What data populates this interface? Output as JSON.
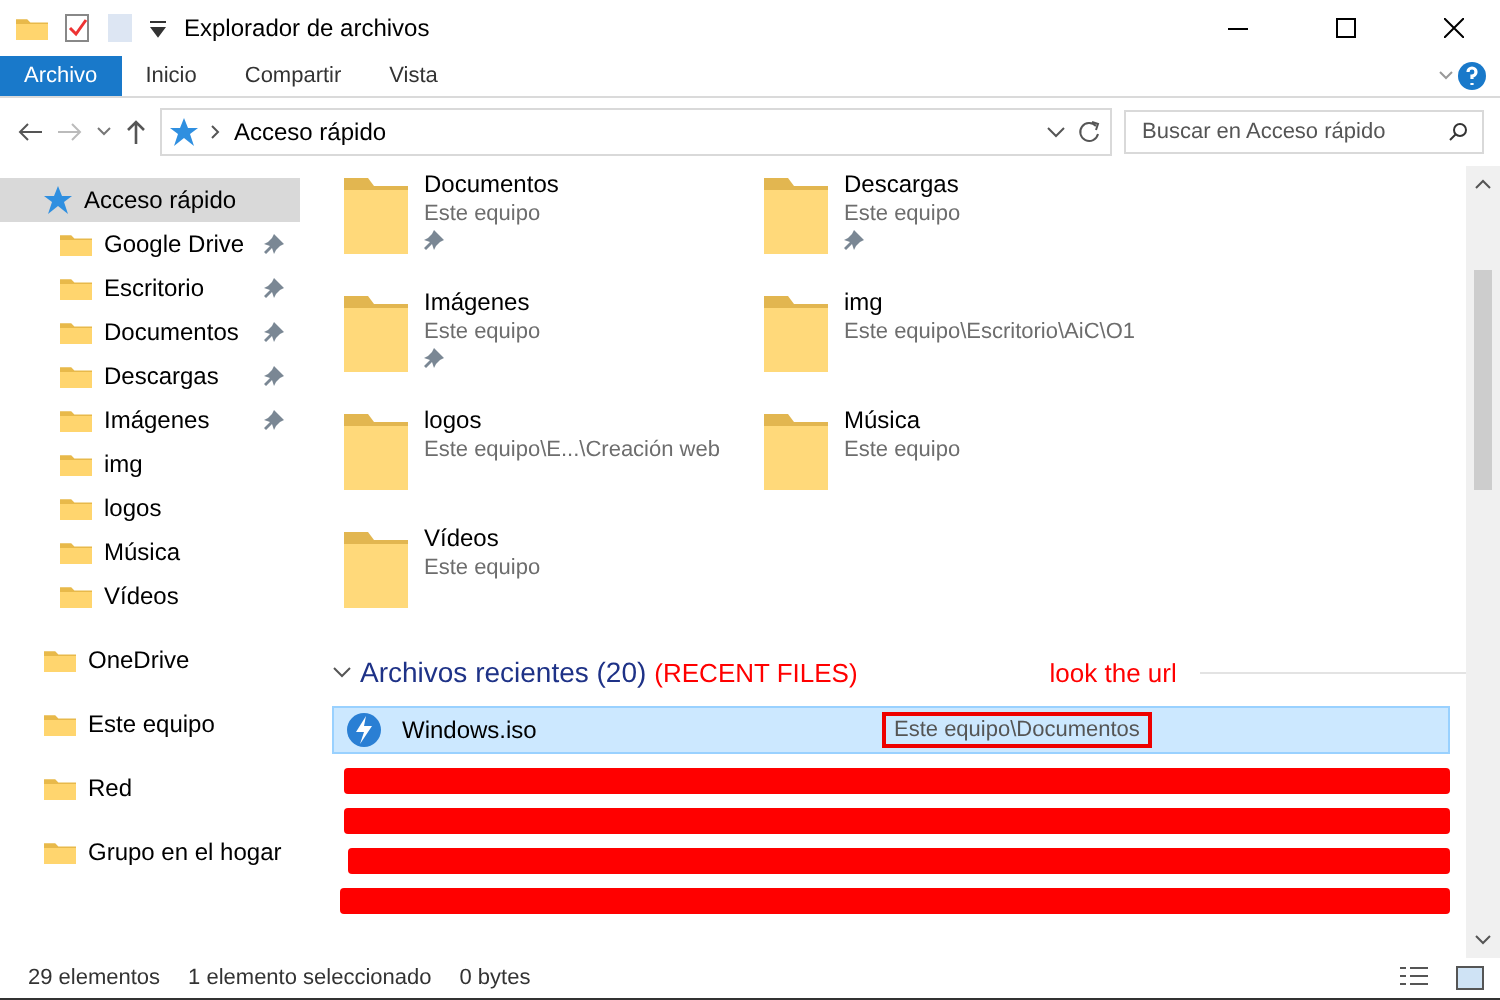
{
  "window": {
    "title": "Explorador de archivos"
  },
  "ribbon_tabs": [
    {
      "label": "Archivo",
      "selected": true
    },
    {
      "label": "Inicio",
      "selected": false
    },
    {
      "label": "Compartir",
      "selected": false
    },
    {
      "label": "Vista",
      "selected": false
    }
  ],
  "address_bar": {
    "path": "Acceso rápido"
  },
  "search": {
    "placeholder": "Buscar en Acceso rápido"
  },
  "sidebar": {
    "items": [
      {
        "label": "Acceso rápido",
        "selected": true,
        "children": [
          {
            "label": "Google Drive",
            "pinned": true
          },
          {
            "label": "Escritorio",
            "pinned": true
          },
          {
            "label": "Documentos",
            "pinned": true
          },
          {
            "label": "Descargas",
            "pinned": true
          },
          {
            "label": "Imágenes",
            "pinned": true
          },
          {
            "label": "img",
            "pinned": false
          },
          {
            "label": "logos",
            "pinned": false
          },
          {
            "label": "Música",
            "pinned": false
          },
          {
            "label": "Vídeos",
            "pinned": false
          }
        ]
      },
      {
        "label": "OneDrive",
        "selected": false
      },
      {
        "label": "Este equipo",
        "selected": false
      },
      {
        "label": "Red",
        "selected": false
      },
      {
        "label": "Grupo en el hogar",
        "selected": false
      }
    ]
  },
  "quick_access": [
    {
      "name": "Documentos",
      "location": "Este equipo",
      "pinned": true
    },
    {
      "name": "Descargas",
      "location": "Este equipo",
      "pinned": true
    },
    {
      "name": "Imágenes",
      "location": "Este equipo",
      "pinned": true
    },
    {
      "name": "img",
      "location": "Este equipo\\Escritorio\\AiC\\O1",
      "pinned": false
    },
    {
      "name": "logos",
      "location": "Este equipo\\E...\\Creación web",
      "pinned": false
    },
    {
      "name": "Música",
      "location": "Este equipo",
      "pinned": false
    },
    {
      "name": "Vídeos",
      "location": "Este equipo",
      "pinned": false
    }
  ],
  "recent": {
    "title": "Archivos recientes (20)",
    "annotation": "(RECENT FILES)",
    "note": "look the url",
    "files": [
      {
        "name": "Windows.iso",
        "location": "Este equipo\\Documentos",
        "selected": true,
        "circled": true
      }
    ]
  },
  "status_bar": {
    "count": "29 elementos",
    "selection": "1 elemento seleccionado",
    "size": "0 bytes"
  }
}
